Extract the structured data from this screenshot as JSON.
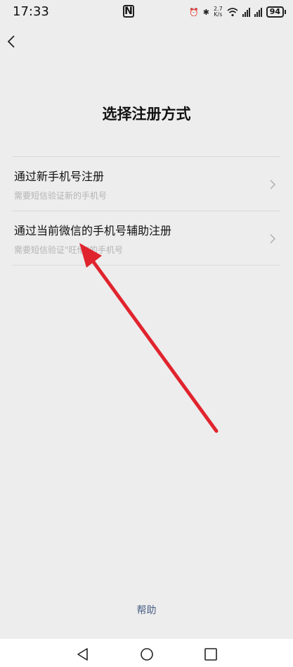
{
  "status_bar": {
    "time": "17:33",
    "nfc": "N",
    "speed_top": "2.7",
    "speed_bottom": "K/s",
    "battery": "94"
  },
  "page": {
    "title": "选择注册方式",
    "options": [
      {
        "title": "通过新手机号注册",
        "subtitle": "需要短信验证新的手机号"
      },
      {
        "title": "通过当前微信的手机号辅助注册",
        "subtitle": "需要短信验证\"旺伦\"的手机号"
      }
    ],
    "help_label": "帮助"
  },
  "colors": {
    "background": "#ededed",
    "annotation_arrow": "#e0242e",
    "link": "#4a5e86"
  },
  "icons": {
    "back": "chevron-left-icon",
    "option_chevron": "chevron-right-icon",
    "nav_back": "triangle-back-icon",
    "nav_home": "circle-home-icon",
    "nav_recent": "square-recents-icon"
  }
}
